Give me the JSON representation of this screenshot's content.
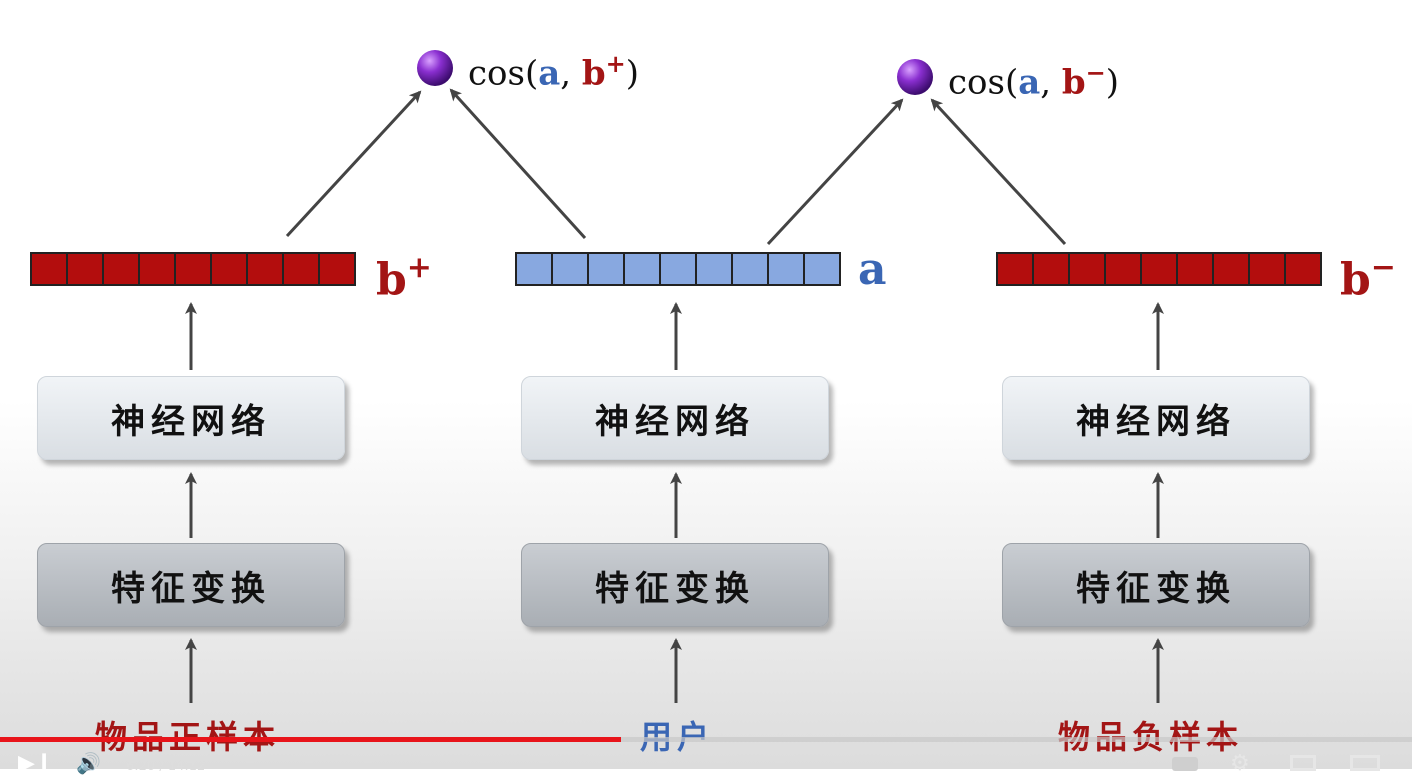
{
  "similarities": {
    "positive": {
      "prefix": "cos(",
      "user": "a",
      "sep": ", ",
      "item": "b",
      "sign": "+",
      "suffix": ")"
    },
    "negative": {
      "prefix": "cos(",
      "user": "a",
      "sep": ", ",
      "item": "b",
      "sign": "−",
      "suffix": ")"
    }
  },
  "vectors": {
    "positive": {
      "symbol": "b",
      "sign": "+",
      "color": "#b30d0d"
    },
    "user": {
      "symbol": "a",
      "color": "#88a8e0"
    },
    "negative": {
      "symbol": "b",
      "sign": "−",
      "color": "#b30d0d"
    }
  },
  "towers": {
    "positive": {
      "network": "神经网络",
      "transform": "特征变换",
      "input": "物品正样本"
    },
    "user": {
      "network": "神经网络",
      "transform": "特征变换",
      "input": "用户"
    },
    "negative": {
      "network": "神经网络",
      "transform": "特征变换",
      "input": "物品负样本"
    }
  },
  "player": {
    "time": "6:20 / 14:12",
    "progress_fraction": 0.44
  }
}
